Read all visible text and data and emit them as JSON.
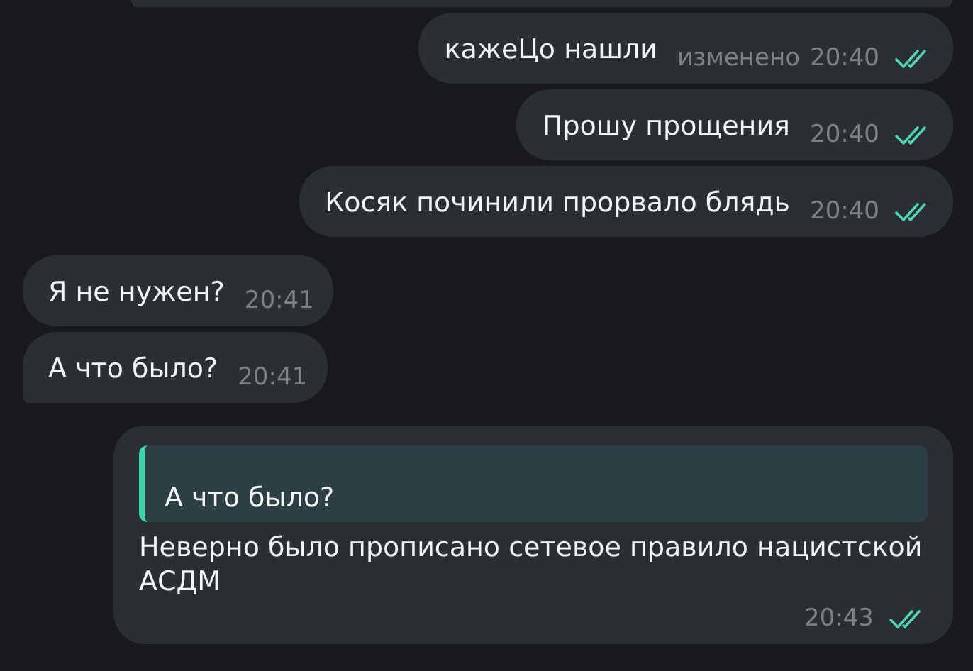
{
  "messages": [
    {
      "kind": "outgoing",
      "clipped": true
    },
    {
      "kind": "outgoing",
      "text": "кажеЦо нашли",
      "edited": "изменено",
      "time": "20:40",
      "read": true
    },
    {
      "kind": "outgoing",
      "text": "Прошу прощения",
      "time": "20:40",
      "read": true
    },
    {
      "kind": "outgoing",
      "text": "Косяк починили прорвало блядь",
      "time": "20:40",
      "read": true
    },
    {
      "kind": "incoming",
      "text": "Я не нужен?",
      "time": "20:41",
      "tail": false
    },
    {
      "kind": "incoming",
      "text": "А что было?",
      "time": "20:41",
      "tail": true
    },
    {
      "kind": "outgoing",
      "reply": {
        "text": "А что было?"
      },
      "text": "Неверно было прописано сетевое правило нацистской АСДМ",
      "time": "20:43",
      "read": true
    }
  ]
}
